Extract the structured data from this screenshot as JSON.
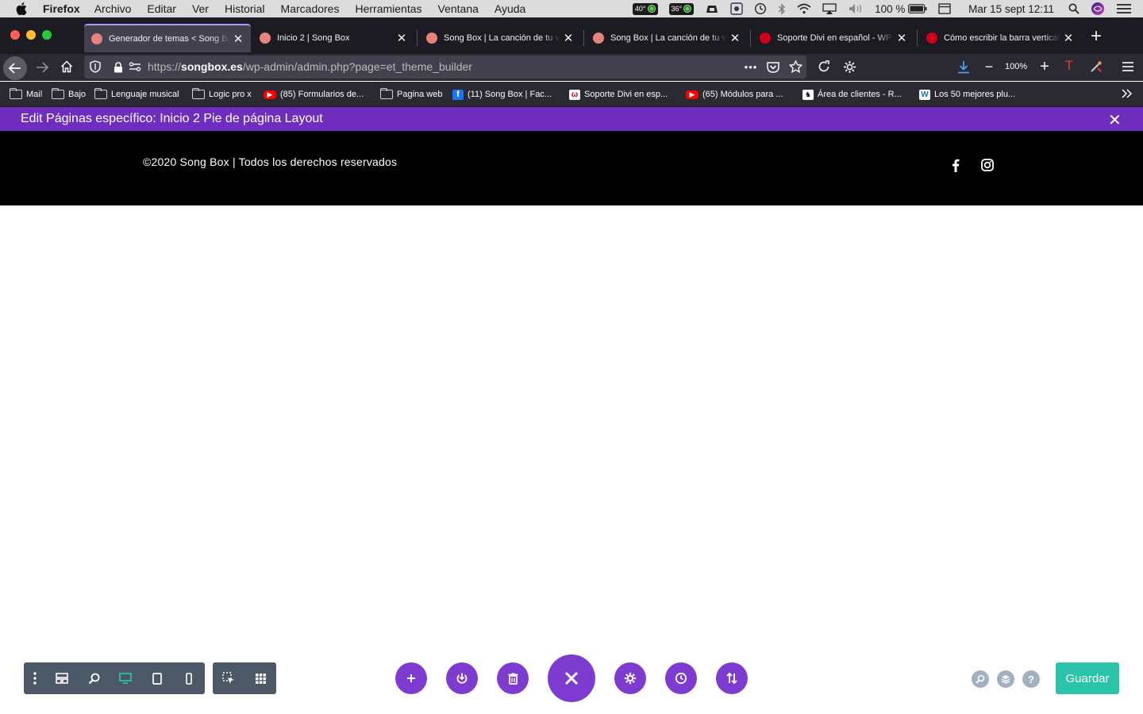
{
  "menubar": {
    "app_name": "Firefox",
    "items": [
      "Archivo",
      "Editar",
      "Ver",
      "Historial",
      "Marcadores",
      "Herramientas",
      "Ventana",
      "Ayuda"
    ],
    "temp1": "40°",
    "temp2": "36°",
    "battery": "100 %",
    "datetime": "Mar 15 sept  12:11"
  },
  "tabs": [
    {
      "title": "Generador de temas < Song Box",
      "active": true,
      "favicon_color": "#e8827d"
    },
    {
      "title": "Inicio 2 | Song Box",
      "active": false,
      "favicon_color": "#e8827d"
    },
    {
      "title": "Song Box | La canción de tu vida",
      "active": false,
      "favicon_color": "#e8827d"
    },
    {
      "title": "Song Box | La canción de tu vida",
      "active": false,
      "favicon_color": "#e8827d"
    },
    {
      "title": "Soporte Divi en español - WP",
      "active": false,
      "favicon_color": "#d0021b"
    },
    {
      "title": "Cómo escribir la barra vertical",
      "active": false,
      "favicon_color": "#d0021b"
    }
  ],
  "address": {
    "prefix": "https://",
    "domain": "songbox.es",
    "path": "/wp-admin/admin.php?page=et_theme_builder",
    "zoom": "100%"
  },
  "bookmarks": [
    {
      "label": "Mail",
      "icon": "folder"
    },
    {
      "label": "Bajo",
      "icon": "folder"
    },
    {
      "label": "Lenguaje musical",
      "icon": "folder"
    },
    {
      "label": "Logic pro x",
      "icon": "folder"
    },
    {
      "label": "(85) Formularios de...",
      "icon": "youtube-icon"
    },
    {
      "label": "Pagina web",
      "icon": "folder"
    },
    {
      "label": "(11) Song Box | Fac...",
      "icon": "facebook-icon"
    },
    {
      "label": "Soporte Divi en esp...",
      "icon": "divi-icon"
    },
    {
      "label": "(65) Módulos para ...",
      "icon": "youtube-icon"
    },
    {
      "label": "Área de clientes - R...",
      "icon": "client-area-icon"
    },
    {
      "label": "Los 50 mejores plu...",
      "icon": "wordpress-icon"
    }
  ],
  "divi_bar": {
    "title": "Edit Páginas específico: Inicio 2 Pie de página Layout"
  },
  "footer": {
    "copyright": "©2020 Song Box | Todos los derechos reservados"
  },
  "builder": {
    "save_label": "Guardar",
    "accent": "#7e3bd0",
    "save_color": "#29c4a9"
  }
}
